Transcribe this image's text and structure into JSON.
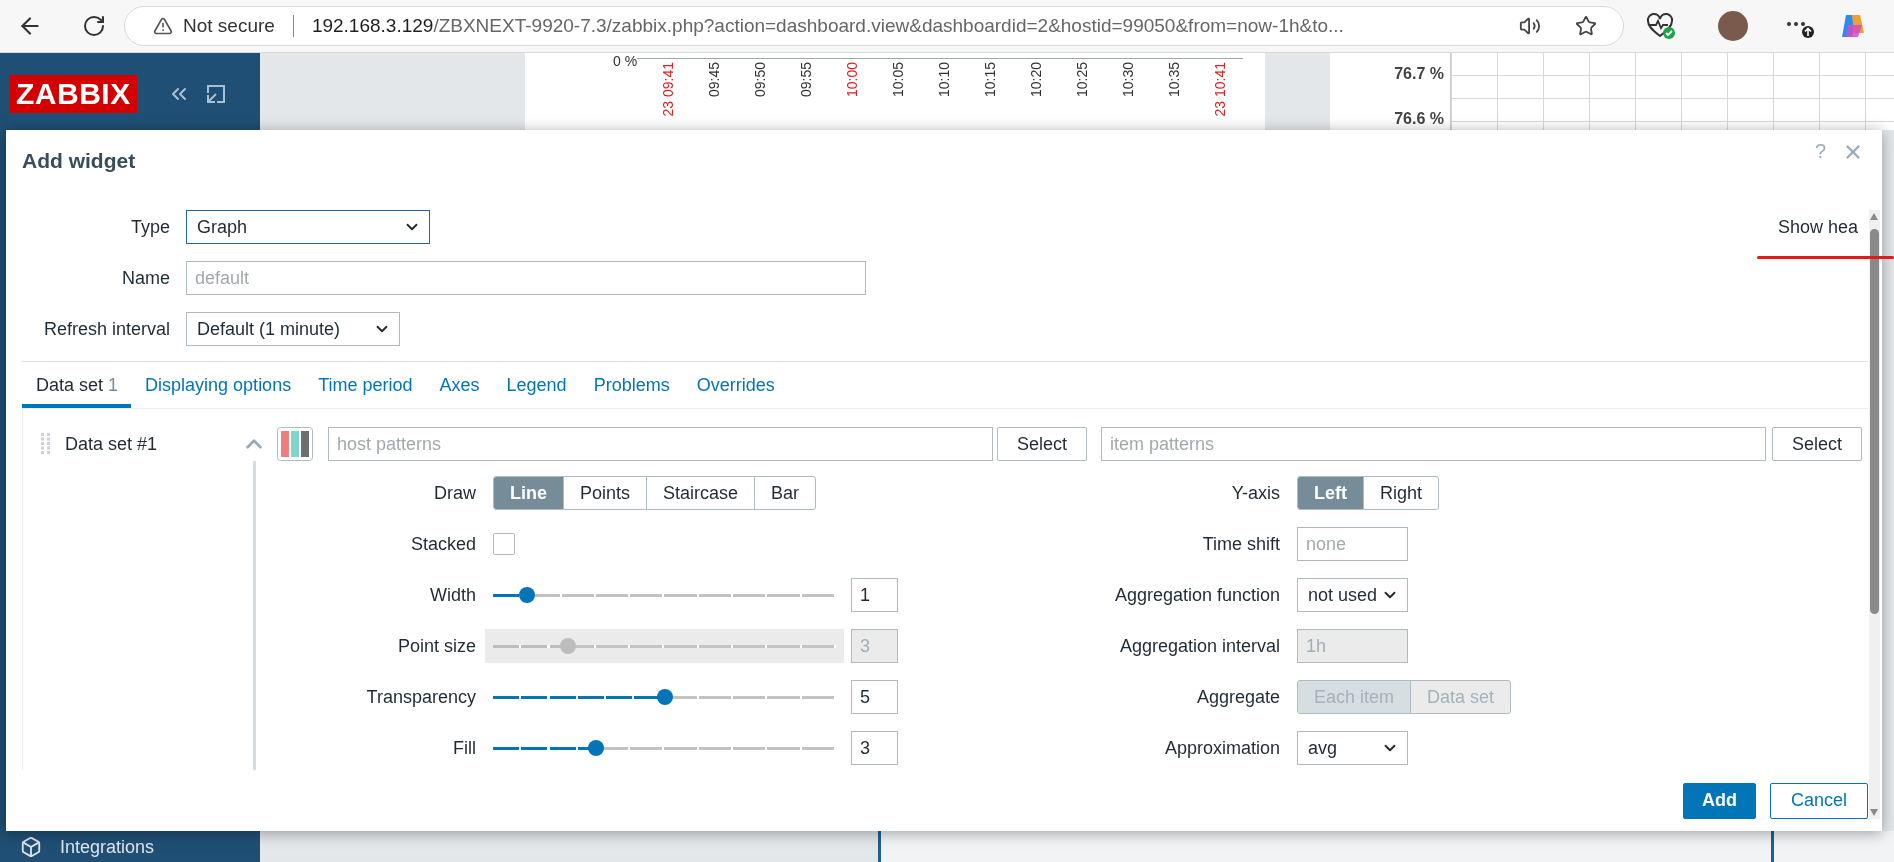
{
  "browser": {
    "security": "Not secure",
    "url_host": "192.168.3.129",
    "url_path": "/ZBXNEXT-9920-7.3/zabbix.php?action=dashboard.view&dashboardid=2&hostid=99050&from=now-1h&to..."
  },
  "sidebar": {
    "logo": "ZABBIX",
    "items": [
      {
        "label": "Integrations"
      }
    ]
  },
  "background": {
    "graph": {
      "y_label": "0 %",
      "time_labels": [
        {
          "text": "23 09:41",
          "highlight": true
        },
        {
          "text": "09:45",
          "highlight": false
        },
        {
          "text": "09:50",
          "highlight": false
        },
        {
          "text": "09:55",
          "highlight": false
        },
        {
          "text": "10:00",
          "highlight": true
        },
        {
          "text": "10:05",
          "highlight": false
        },
        {
          "text": "10:10",
          "highlight": false
        },
        {
          "text": "10:15",
          "highlight": false
        },
        {
          "text": "10:20",
          "highlight": false
        },
        {
          "text": "10:25",
          "highlight": false
        },
        {
          "text": "10:30",
          "highlight": false
        },
        {
          "text": "10:35",
          "highlight": false
        },
        {
          "text": "23 10:41",
          "highlight": true
        }
      ]
    },
    "right_widget": {
      "values": [
        "76.7 %",
        "76.6 %"
      ]
    }
  },
  "dialog": {
    "title": "Add widget",
    "help": "?",
    "fields": [
      {
        "label": "Type",
        "kind": "select",
        "value": "Graph",
        "focused": true
      },
      {
        "label": "Name",
        "kind": "text",
        "placeholder": "default"
      },
      {
        "label": "Refresh interval",
        "kind": "select",
        "value": "Default (1 minute)",
        "focused": false
      }
    ],
    "show_header_label": "Show hea",
    "tabs": [
      {
        "label": "Data set",
        "count": "1",
        "selected": true
      },
      {
        "label": "Displaying options",
        "selected": false
      },
      {
        "label": "Time period",
        "selected": false
      },
      {
        "label": "Axes",
        "selected": false
      },
      {
        "label": "Legend",
        "selected": false
      },
      {
        "label": "Problems",
        "selected": false
      },
      {
        "label": "Overrides",
        "selected": false
      }
    ],
    "datasets": [
      {
        "name": "Data set #1",
        "expanded": true,
        "host_placeholder": "host patterns",
        "item_placeholder": "item patterns",
        "host_select": "Select",
        "item_select": "Select",
        "left_options": [
          {
            "kind": "segmented",
            "label": "Draw",
            "disabled": false,
            "options": [
              {
                "label": "Line",
                "selected": true
              },
              {
                "label": "Points",
                "selected": false
              },
              {
                "label": "Staircase",
                "selected": false
              },
              {
                "label": "Bar",
                "selected": false
              }
            ]
          },
          {
            "kind": "checkbox",
            "label": "Stacked",
            "checked": false
          },
          {
            "kind": "slider",
            "label": "Width",
            "level": 0.1,
            "value": "1",
            "disabled": false
          },
          {
            "kind": "slider",
            "label": "Point size",
            "level": 0.22,
            "value": "3",
            "disabled": true
          },
          {
            "kind": "slider",
            "label": "Transparency",
            "level": 0.5,
            "value": "5",
            "disabled": false
          },
          {
            "kind": "slider",
            "label": "Fill",
            "level": 0.3,
            "value": "3",
            "disabled": false
          }
        ],
        "right_options": [
          {
            "kind": "segmented",
            "label": "Y-axis",
            "disabled": false,
            "options": [
              {
                "label": "Left",
                "selected": true
              },
              {
                "label": "Right",
                "selected": false
              }
            ]
          },
          {
            "kind": "text",
            "label": "Time shift",
            "placeholder": "none",
            "disabled": false
          },
          {
            "kind": "select",
            "label": "Aggregation function",
            "value": "not used"
          },
          {
            "kind": "text",
            "label": "Aggregation interval",
            "value": "1h",
            "disabled": true
          },
          {
            "kind": "segmented",
            "label": "Aggregate",
            "disabled": true,
            "options": [
              {
                "label": "Each item",
                "selected": true
              },
              {
                "label": "Data set",
                "selected": false
              }
            ]
          },
          {
            "kind": "select",
            "label": "Approximation",
            "value": "avg"
          }
        ]
      }
    ],
    "buttons": [
      {
        "label": "Add",
        "kind": "primary"
      },
      {
        "label": "Cancel",
        "kind": "secondary"
      }
    ]
  }
}
